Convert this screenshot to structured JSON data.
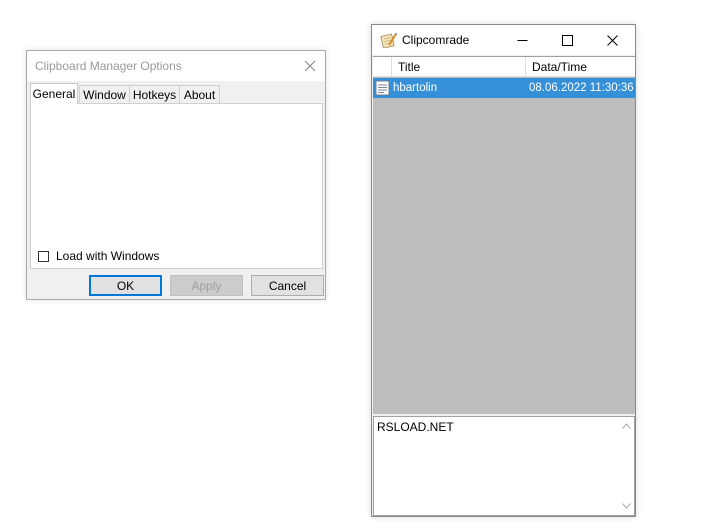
{
  "options_dialog": {
    "title": "Clipboard Manager Options",
    "tabs": [
      {
        "label": "General"
      },
      {
        "label": "Window"
      },
      {
        "label": "Hotkeys"
      },
      {
        "label": "About"
      }
    ],
    "active_tab": "General",
    "load_with_windows": {
      "label": "Load with Windows",
      "checked": false
    },
    "buttons": {
      "ok": "OK",
      "apply": "Apply",
      "cancel": "Cancel"
    },
    "icons": {
      "close": "close-icon"
    }
  },
  "clip_window": {
    "title": "Clipcomrade",
    "icons": {
      "app": "notepad-pencil-icon",
      "minimize": "minimize-icon",
      "maximize": "maximize-icon",
      "close": "close-icon"
    },
    "columns": [
      "Title",
      "Data/Time"
    ],
    "rows": [
      {
        "title": "hbartolin",
        "datetime": "08.06.2022 11:30:36",
        "selected": true
      }
    ],
    "preview_text": "RSLOAD.NET",
    "colors": {
      "selection": "#3590d8",
      "list_background": "#bdbdbd"
    }
  }
}
